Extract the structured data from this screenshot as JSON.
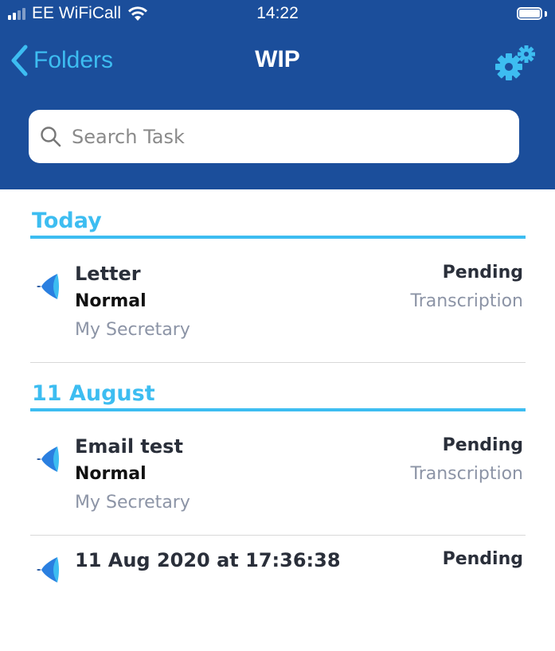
{
  "status_bar": {
    "carrier": "EE WiFiCall",
    "time": "14:22"
  },
  "nav": {
    "back_label": "Folders",
    "title": "WIP"
  },
  "search": {
    "placeholder": "Search Task"
  },
  "colors": {
    "header_bg": "#1b4e9b",
    "accent": "#3dbdf1"
  },
  "sections": [
    {
      "title": "Today",
      "tasks": [
        {
          "name": "Letter",
          "priority": "Normal",
          "assignee": "My Secretary",
          "status": "Pending",
          "stage": "Transcription"
        }
      ]
    },
    {
      "title": "11 August",
      "tasks": [
        {
          "name": "Email test",
          "priority": "Normal",
          "assignee": "My Secretary",
          "status": "Pending",
          "stage": "Transcription"
        },
        {
          "name": "11 Aug 2020 at 17:36:38",
          "priority": "",
          "assignee": "",
          "status": "Pending",
          "stage": ""
        }
      ]
    }
  ]
}
